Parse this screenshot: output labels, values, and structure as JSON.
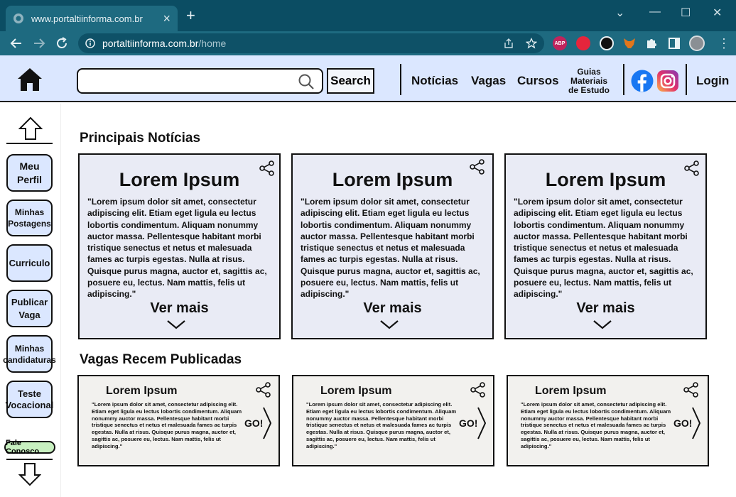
{
  "browser": {
    "tab_title": "www.portaltiinforma.com.br",
    "new_tab": "+",
    "url_host": "portaltiinforma.com.br",
    "url_path": "/home",
    "ext_abp": "ABP"
  },
  "header": {
    "search_button": "Search",
    "nav": {
      "noticias": "Notícias",
      "vagas": "Vagas",
      "cursos": "Cursos",
      "guias": "Guias Materiais de Estudo",
      "login": "Login"
    }
  },
  "sidebar": {
    "items": [
      "Meu Perfil",
      "Minhas Postagens",
      "Curriculo",
      "Publicar Vaga",
      "Minhas candidaturas",
      "Teste Vocacional"
    ],
    "fale_conosco": "Fale Conosco"
  },
  "sections": {
    "news_title": "Principais Notícias",
    "jobs_title": "Vagas Recem Publicadas"
  },
  "news_cards": [
    {
      "title": "Lorem Ipsum",
      "body": "\"Lorem ipsum dolor sit amet, consectetur adipiscing elit. Etiam eget ligula eu lectus lobortis condimentum. Aliquam nonummy auctor massa. Pellentesque habitant morbi tristique senectus et netus et malesuada fames ac turpis egestas. Nulla at risus. Quisque purus magna, auctor et, sagittis ac, posuere eu, lectus. Nam mattis, felis ut adipiscing.\"",
      "more": "Ver mais"
    },
    {
      "title": "Lorem Ipsum",
      "body": "\"Lorem ipsum dolor sit amet, consectetur adipiscing elit. Etiam eget ligula eu lectus lobortis condimentum. Aliquam nonummy auctor massa. Pellentesque habitant morbi tristique senectus et netus et malesuada fames ac turpis egestas. Nulla at risus. Quisque purus magna, auctor et, sagittis ac, posuere eu, lectus. Nam mattis, felis ut adipiscing.\"",
      "more": "Ver mais"
    },
    {
      "title": "Lorem Ipsum",
      "body": "\"Lorem ipsum dolor sit amet, consectetur adipiscing elit. Etiam eget ligula eu lectus lobortis condimentum. Aliquam nonummy auctor massa. Pellentesque habitant morbi tristique senectus et netus et malesuada fames ac turpis egestas. Nulla at risus. Quisque purus magna, auctor et, sagittis ac, posuere eu, lectus. Nam mattis, felis ut adipiscing.\"",
      "more": "Ver mais"
    }
  ],
  "job_cards": [
    {
      "title": "Lorem Ipsum",
      "body": "\"Lorem ipsum dolor sit amet, consectetur adipiscing elit. Etiam eget ligula eu lectus lobortis condimentum. Aliquam nonummy auctor massa. Pellentesque habitant morbi tristique senectus et netus et malesuada fames ac turpis egestas. Nulla at risus. Quisque purus magna, auctor et, sagittis ac, posuere eu, lectus. Nam mattis, felis ut adipiscing.\"",
      "go": "GO!"
    },
    {
      "title": "Lorem Ipsum",
      "body": "\"Lorem ipsum dolor sit amet, consectetur adipiscing elit. Etiam eget ligula eu lectus lobortis condimentum. Aliquam nonummy auctor massa. Pellentesque habitant morbi tristique senectus et netus et malesuada fames ac turpis egestas. Nulla at risus. Quisque purus magna, auctor et, sagittis ac, posuere eu, lectus. Nam mattis, felis ut adipiscing.\"",
      "go": "GO!"
    },
    {
      "title": "Lorem Ipsum",
      "body": "\"Lorem ipsum dolor sit amet, consectetur adipiscing elit. Etiam eget ligula eu lectus lobortis condimentum. Aliquam nonummy auctor massa. Pellentesque habitant morbi tristique senectus et netus et malesuada fames ac turpis egestas. Nulla at risus. Quisque purus magna, auctor et, sagittis ac, posuere eu, lectus. Nam mattis, felis ut adipiscing.\"",
      "go": "GO!"
    }
  ],
  "colors": {
    "chrome_dark": "#0b4d63",
    "chrome_mid": "#1e6a80",
    "header_bg": "#dbe7ff",
    "news_card_bg": "#e9ebf5",
    "job_card_bg": "#f2f1ee",
    "fale_bg": "#c8f0c0",
    "facebook": "#1877f2"
  }
}
